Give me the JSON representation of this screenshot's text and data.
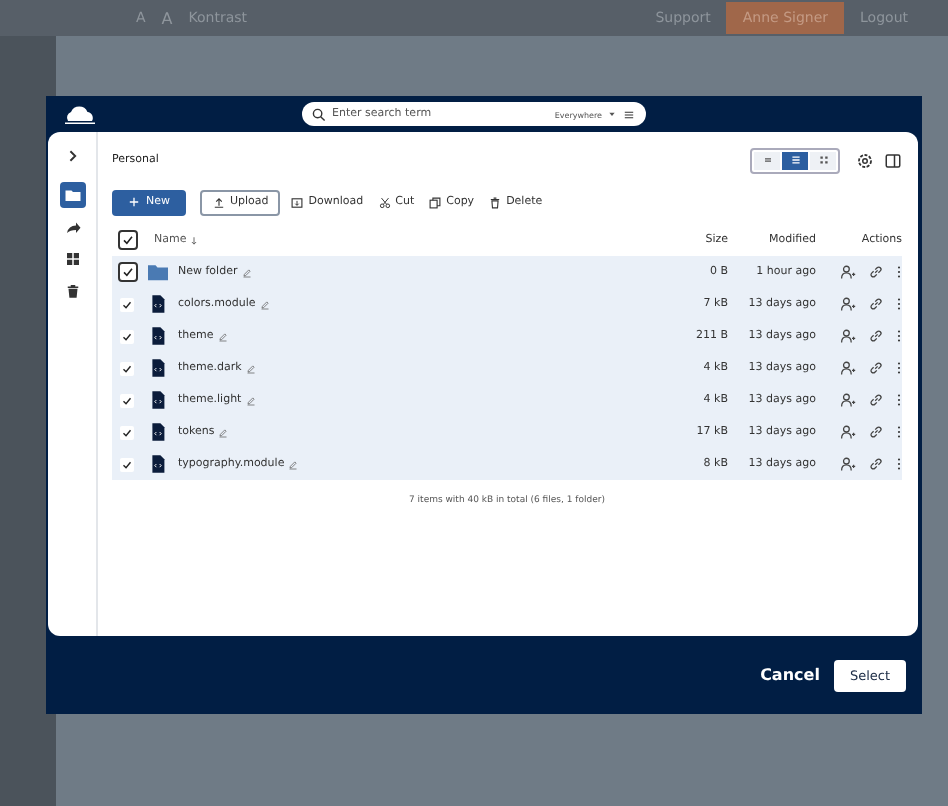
{
  "background": {
    "topbar": {
      "font_buttons": [
        "A",
        "A"
      ],
      "contrast": "Kontrast",
      "support": "Support",
      "user_button": "Anne Signer",
      "logout": "Logout"
    }
  },
  "dialog": {
    "search": {
      "placeholder": "Enter search term",
      "scope": "Everywhere"
    },
    "nav": [
      {
        "kind": "files",
        "selected": true
      },
      {
        "kind": "shares",
        "selected": false
      },
      {
        "kind": "spaces",
        "selected": false
      },
      {
        "kind": "trash",
        "selected": false
      }
    ],
    "breadcrumb": "Personal",
    "views": [
      {
        "kind": "compact",
        "selected": false
      },
      {
        "kind": "list",
        "selected": true
      },
      {
        "kind": "tiles",
        "selected": false
      }
    ],
    "toolbar": [
      {
        "kind": "new",
        "label": "New"
      },
      {
        "kind": "upload",
        "label": "Upload"
      },
      {
        "kind": "download",
        "label": "Download"
      },
      {
        "kind": "cut",
        "label": "Cut"
      },
      {
        "kind": "copy",
        "label": "Copy"
      },
      {
        "kind": "delete",
        "label": "Delete"
      }
    ],
    "columns": {
      "name": "Name",
      "size": "Size",
      "modified": "Modified",
      "actions": "Actions"
    },
    "all_checked": true,
    "rows": [
      {
        "kind": "folder",
        "name": "New folder",
        "size": "0 B",
        "modified": "1 hour ago",
        "checked": true
      },
      {
        "kind": "file",
        "name": "colors.module",
        "size": "7 kB",
        "modified": "13 days ago",
        "checked": true
      },
      {
        "kind": "file",
        "name": "theme",
        "size": "211 B",
        "modified": "13 days ago",
        "checked": true
      },
      {
        "kind": "file",
        "name": "theme.dark",
        "size": "4 kB",
        "modified": "13 days ago",
        "checked": true
      },
      {
        "kind": "file",
        "name": "theme.light",
        "size": "4 kB",
        "modified": "13 days ago",
        "checked": true
      },
      {
        "kind": "file",
        "name": "tokens",
        "size": "17 kB",
        "modified": "13 days ago",
        "checked": true
      },
      {
        "kind": "file",
        "name": "typography.module",
        "size": "8 kB",
        "modified": "13 days ago",
        "checked": true
      }
    ],
    "summary": "7 items with 40 kB in total (6 files, 1 folder)",
    "buttons": {
      "cancel": "Cancel",
      "select": "Select"
    }
  }
}
